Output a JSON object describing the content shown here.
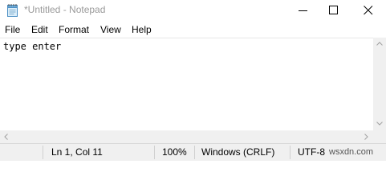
{
  "window": {
    "title": "*Untitled - Notepad"
  },
  "menu": {
    "items": [
      {
        "label": "File"
      },
      {
        "label": "Edit"
      },
      {
        "label": "Format"
      },
      {
        "label": "View"
      },
      {
        "label": "Help"
      }
    ]
  },
  "editor": {
    "content": "type enter"
  },
  "status": {
    "position": "Ln 1, Col 11",
    "zoom": "100%",
    "line_ending": "Windows (CRLF)",
    "encoding": "UTF-8",
    "watermark": "wsxdn.com"
  },
  "icons": {
    "app": "notepad-icon",
    "minimize": "minimize-icon",
    "maximize": "maximize-icon",
    "close": "close-icon"
  }
}
